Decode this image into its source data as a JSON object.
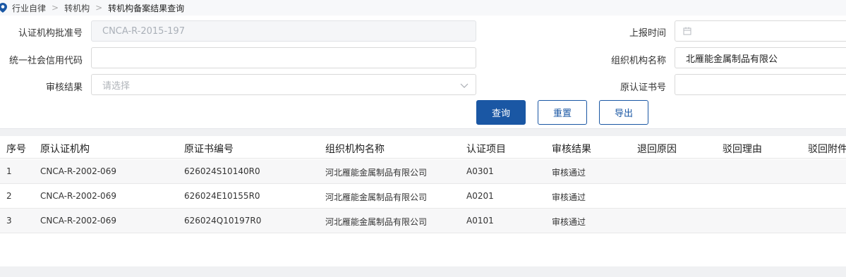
{
  "breadcrumb": {
    "items": [
      "行业自律",
      "转机构",
      "转机构备案结果查询"
    ],
    "separator": ">"
  },
  "form": {
    "approval_no": {
      "label": "认证机构批准号",
      "value": "CNCA-R-2015-197"
    },
    "report_time": {
      "label": "上报时间",
      "value": ""
    },
    "credit_code": {
      "label": "统一社会信用代码",
      "value": ""
    },
    "org_name": {
      "label": "组织机构名称",
      "value": "北雁能金属制品有限公"
    },
    "review_result": {
      "label": "审核结果",
      "placeholder": "请选择"
    },
    "orig_cert_no": {
      "label": "原认证书号",
      "value": ""
    }
  },
  "buttons": {
    "query": "查询",
    "reset": "重置",
    "export": "导出"
  },
  "table": {
    "headers": [
      "序号",
      "原认证机构",
      "原证书编号",
      "组织机构名称",
      "认证项目",
      "审核结果",
      "退回原因",
      "驳回理由",
      "驳回附件"
    ],
    "rows": [
      [
        "1",
        "CNCA-R-2002-069",
        "626024S10140R0",
        "河北雁能金属制品有限公司",
        "A0301",
        "审核通过",
        "",
        "",
        ""
      ],
      [
        "2",
        "CNCA-R-2002-069",
        "626024E10155R0",
        "河北雁能金属制品有限公司",
        "A0201",
        "审核通过",
        "",
        "",
        ""
      ],
      [
        "3",
        "CNCA-R-2002-069",
        "626024Q10197R0",
        "河北雁能金属制品有限公司",
        "A0101",
        "审核通过",
        "",
        "",
        ""
      ]
    ]
  },
  "icons": {
    "breadcrumb": "location-pin-icon",
    "calendar": "calendar-icon",
    "dropdown": "chevron-down-icon"
  },
  "colors": {
    "primary": "#1a57a4",
    "breadcrumb_pin": "#1a57a4"
  }
}
